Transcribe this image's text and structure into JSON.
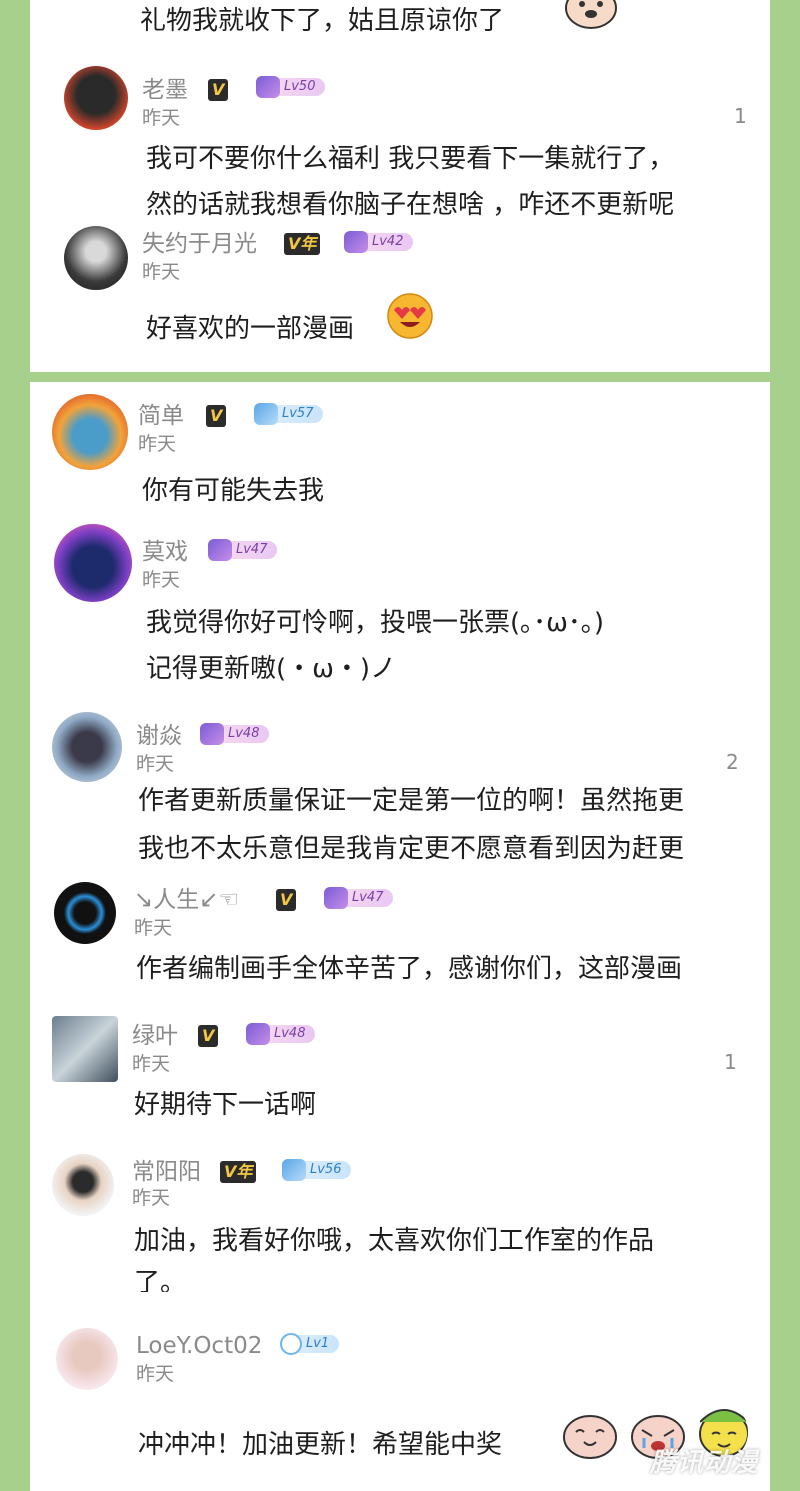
{
  "comments_top": {
    "c0": {
      "text": "礼物我就收下了，姑且原谅你了",
      "emoji": "dog-face-emoji"
    },
    "c1": {
      "name": "老墨",
      "vip": "V",
      "level": "Lv50",
      "date": "昨天",
      "count": "1",
      "line1": "我可不要你什么福利 我只要看下一集就行了，",
      "line2": "然的话就我想看你脑子在想啥 ，咋还不更新呢"
    },
    "c2": {
      "name": "失约于月光",
      "vip": "V年",
      "level": "Lv42",
      "date": "昨天",
      "line1": "好喜欢的一部漫画",
      "emoji": "heart-eyes-emoji"
    }
  },
  "comments": {
    "c3": {
      "name": "简单",
      "vip": "V",
      "level": "Lv57",
      "date": "昨天",
      "line1": "你有可能失去我"
    },
    "c4": {
      "name": "莫戏",
      "level": "Lv47",
      "date": "昨天",
      "line1": "我觉得你好可怜啊，投喂一张票(｡･ω･｡)",
      "line2": "记得更新嗷(・ω・)ノ"
    },
    "c5": {
      "name": "谢焱",
      "level": "Lv48",
      "date": "昨天",
      "count": "2",
      "line1": "作者更新质量保证一定是第一位的啊！虽然拖更",
      "line2": "我也不太乐意但是我肯定更不愿意看到因为赶更"
    },
    "c6": {
      "name": "↘人生↙☜",
      "vip": "V",
      "level": "Lv47",
      "date": "昨天",
      "line1": "作者编制画手全体辛苦了，感谢你们，这部漫画"
    },
    "c7": {
      "name": "绿叶",
      "vip": "V",
      "level": "Lv48",
      "date": "昨天",
      "count": "1",
      "line1": "好期待下一话啊"
    },
    "c8": {
      "name": "常阳阳",
      "vip": "V年",
      "level": "Lv56",
      "date": "昨天",
      "line1": "加油，我看好你哦，太喜欢你们工作室的作品",
      "line2": "了。"
    },
    "c9": {
      "name": "LoeY.Oct02",
      "level": "Lv1",
      "date": "昨天",
      "line1": "冲冲冲！加油更新！希望能中奖"
    }
  },
  "watermark": "腾讯动漫",
  "colors": {
    "frame": "#a8d08d",
    "panel": "#ffffff",
    "meta": "#8a8a8a",
    "text": "#1e1e1e"
  }
}
